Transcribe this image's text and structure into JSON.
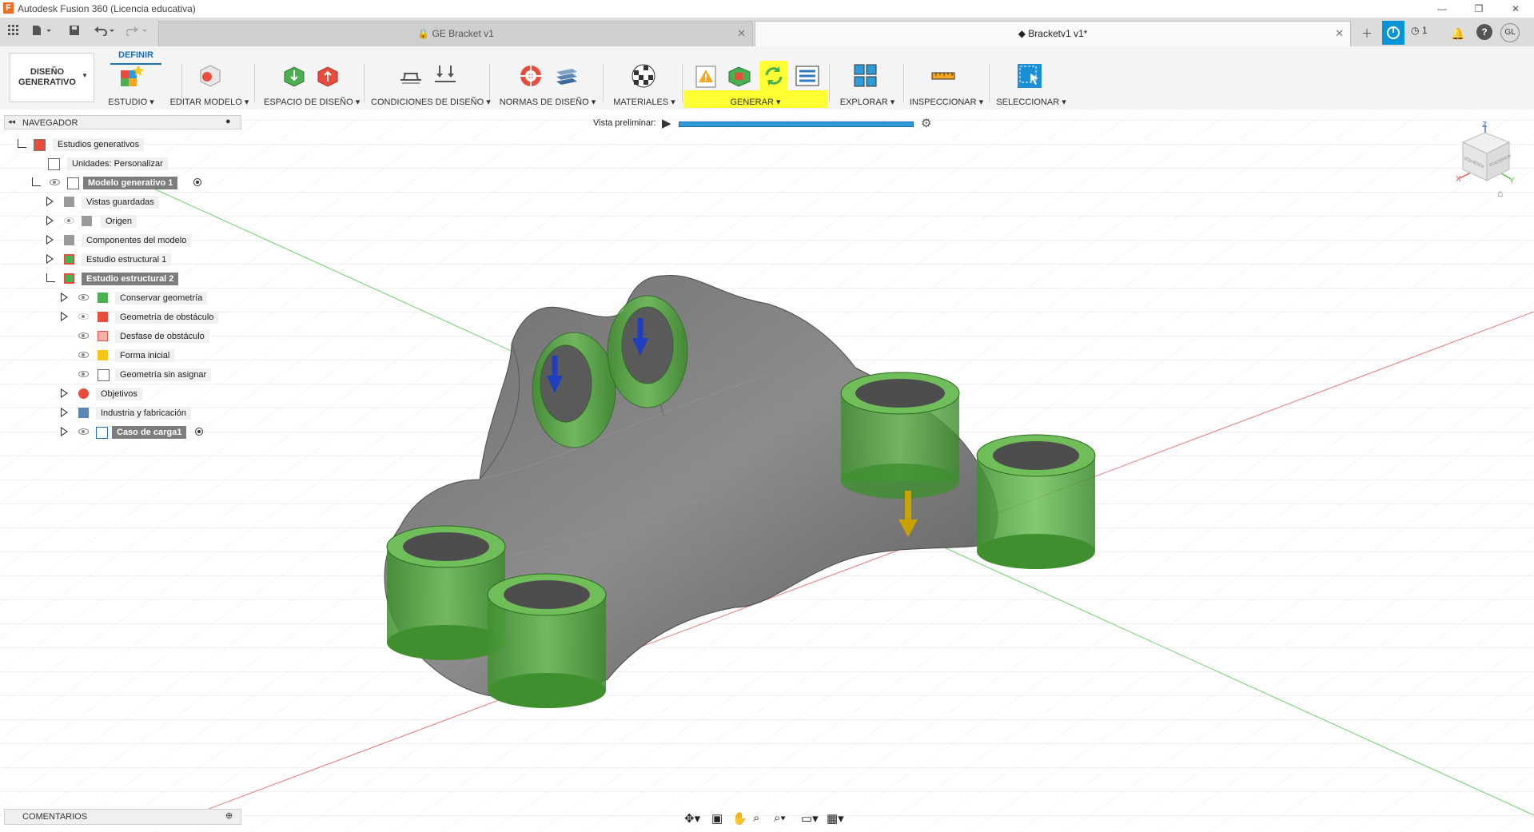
{
  "window": {
    "title": "Autodesk Fusion 360 (Licencia educativa)",
    "logo_letter": "F"
  },
  "tabs": [
    {
      "label": "GE Bracket v1",
      "active": false
    },
    {
      "label": "Bracketv1 v1*",
      "active": true
    }
  ],
  "header_right": {
    "jobs_count": "1",
    "user_initials": "GL"
  },
  "ribbon": {
    "workspace_line1": "DISEÑO",
    "workspace_line2": "GENERATIVO",
    "active_tab": "DEFINIR",
    "groups": [
      "ESTUDIO",
      "EDITAR MODELO",
      "ESPACIO DE DISEÑO",
      "CONDICIONES DE DISEÑO",
      "NORMAS DE DISEÑO",
      "MATERIALES",
      "GENERAR",
      "EXPLORAR",
      "INSPECCIONAR",
      "SELECCIONAR"
    ],
    "highlight_color": "#ffff33",
    "accent_color": "#1b6fb9"
  },
  "navigator": {
    "title": "NAVEGADOR",
    "items": [
      {
        "label": "Estudios generativos"
      },
      {
        "label": "Unidades: Personalizar"
      },
      {
        "label": "Modelo generativo 1"
      },
      {
        "label": "Vistas guardadas"
      },
      {
        "label": "Origen"
      },
      {
        "label": "Componentes del modelo"
      },
      {
        "label": "Estudio estructural 1"
      },
      {
        "label": "Estudio estructural 2"
      },
      {
        "label": "Conservar geometría"
      },
      {
        "label": "Geometría de obstáculo"
      },
      {
        "label": "Desfase de obstáculo"
      },
      {
        "label": "Forma inicial"
      },
      {
        "label": "Geometría sin asignar"
      },
      {
        "label": "Objetivos"
      },
      {
        "label": "Industria y fabricación"
      },
      {
        "label": "Caso de carga1"
      }
    ]
  },
  "preview": {
    "label": "Vista preliminar:"
  },
  "viewcube": {
    "axis_x": "X",
    "axis_y": "Y",
    "axis_z": "Z",
    "face_left": "IZQUIERDA",
    "face_right": "POSTERIOR"
  },
  "comments": {
    "title": "COMENTARIOS"
  },
  "icons": [
    "grid-icon",
    "file-icon",
    "save-icon",
    "undo-icon",
    "redo-icon",
    "close-icon",
    "add-tab-icon",
    "online-icon",
    "clock-icon",
    "bell-icon",
    "help-icon",
    "play-icon",
    "settings-icon",
    "orbit-icon",
    "look-at-icon",
    "pan-icon",
    "zoom-icon",
    "zoom-window-icon",
    "display-icon",
    "grid-settings-icon"
  ]
}
